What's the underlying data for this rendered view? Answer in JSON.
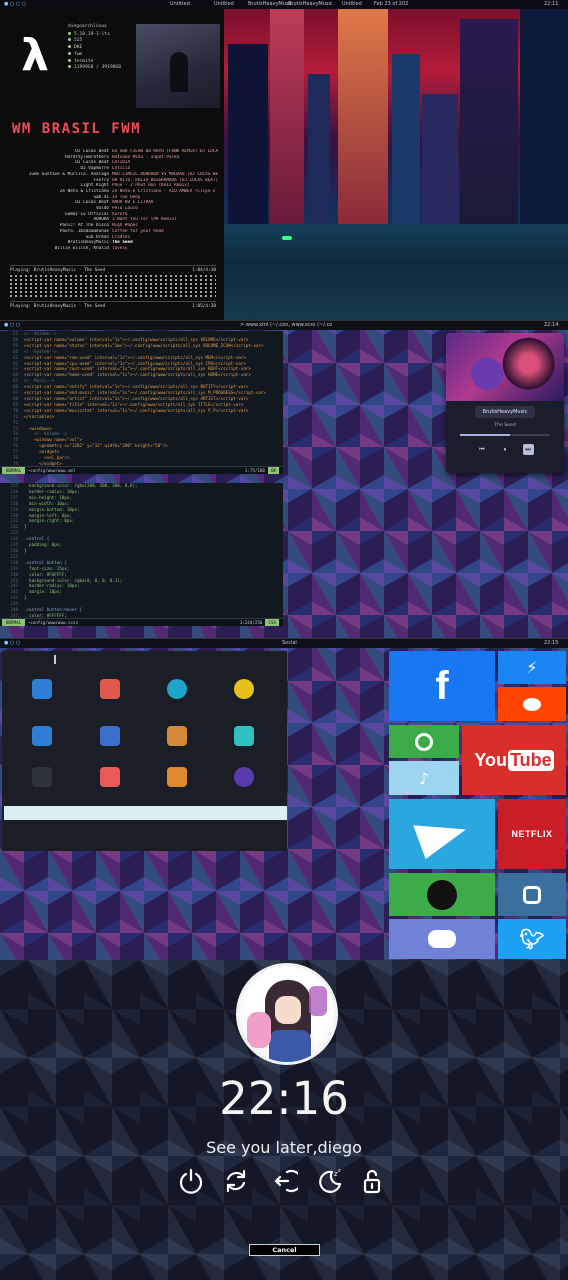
{
  "panel1": {
    "bar": {
      "tabs": [
        "Untitled",
        "Untitled",
        "BrutisHeavyMusic",
        "BrutisHeavyMusic",
        "Untitled"
      ],
      "status_text": "Feb 23 of 202",
      "time": "22:11"
    },
    "fetch": {
      "user": "diegoarchlinux",
      "lines": [
        "5.18.19-1-lts",
        "525",
        "DKE",
        "fwm",
        "termite",
        "11999GB / 39198GB"
      ]
    },
    "station": "WM BRASIL FWM",
    "songs": [
      {
        "artist": "DJ Lucas Beat",
        "title": "EU SOU FILHO DO RAYO (FUNK REMIX) DJ LUCA"
      },
      {
        "artist": "HardstyleBrothers",
        "title": "Hatsune Miku - Inpot Polka"
      },
      {
        "artist": "DJ Lucas Beat",
        "title": "LATIDIA"
      },
      {
        "artist": "DJ Vapmorre",
        "title": "Leticia"
      },
      {
        "artist": "Jude Gustave & Murillo. Analaga",
        "title": "MEU LIMEIL DOBRADO VS MAGRÃO (DJ LUCAS BE"
      },
      {
        "artist": "Fserry",
        "title": "OH RITO, POLIA DESGRAMADA (DJ LUCAS BEAT)"
      },
      {
        "artist": "Light Right",
        "title": "Phue - 2 Phut Hon (KAIZ Remix)"
      },
      {
        "artist": "Zé Neto & Cristiano",
        "title": "Zé Neto e Cristiano - ALÔ AMBEV (Clipe o"
      },
      {
        "artist": "Sam 41",
        "title": "In Too Deep"
      },
      {
        "artist": "DJ Lucas Beat",
        "title": "AMOR DU É LITRÃO"
      },
      {
        "artist": "Valdo",
        "title": "Pelo Louco"
      },
      {
        "artist": "Gomez Lo Official",
        "title": "Aurora"
      },
      {
        "artist": "AURORA",
        "title": "I Want You For (PK Remix)"
      },
      {
        "artist": "Panic! At The Disco",
        "title": "High Hopes"
      },
      {
        "artist": "Paufo. Imadamaduhae",
        "title": "Coffee for your head"
      },
      {
        "artist": "Sub Urban",
        "title": "Cradles"
      },
      {
        "artist": "BrutisHeavyMusic",
        "title": "The Seed"
      },
      {
        "artist": "Billie Eilish, Khalid",
        "title": "lovely"
      }
    ],
    "playing": "Playing: BrutisHeavyMusic - The Seed",
    "time_a": "1:04/4:30",
    "time_b": "1:05/4:30"
  },
  "panel2": {
    "bar": {
      "text": "> www.xml (~/.con, www.scss (~/.co",
      "time": "22:14"
    },
    "code_top": [
      {
        "n": "57",
        "t": "<!--Volume-->"
      },
      {
        "n": "58",
        "t": "<script-var name=\"volume\" interval=\"1s\">~/.config/www/scripts/all_sys VOLUME</script-var>"
      },
      {
        "n": "59",
        "t": "<script-var name=\"status\" interval=\"1ms\">~/.config/www/scripts/all_sys VOLUME_ICON</script-var>"
      },
      {
        "n": "60",
        "t": "<!--System-->"
      },
      {
        "n": "61",
        "t": "<script-var name=\"ram-used\" interval=\"1s\">~/.config/www/scripts/all_sys MEM</script-var>"
      },
      {
        "n": "62",
        "t": "<script-var name=\"cpu-used\" interval=\"1s\">~/.config/www/scripts/all_sys CPU</script-var>"
      },
      {
        "n": "63",
        "t": "<script-var name=\"root-used\" interval=\"1s\">~/.config/www/scripts/all_sys ROOT</script-var>"
      },
      {
        "n": "64",
        "t": "<script-var name=\"home-used\" interval=\"1s\">~/.config/www/scripts/all_sys HOME</script-var>"
      },
      {
        "n": "65",
        "t": "<!--Music-->"
      },
      {
        "n": "66",
        "t": "<script-var name=\"notify\" interval=\"1s\">~/.config/www/scripts/all_sys NOTIFY</script-var>"
      },
      {
        "n": "67",
        "t": "<script-var name=\"end-music\" interval=\"1s\">~/.config/www/scripts/all_sys M_PROGRESS</script-var>"
      },
      {
        "n": "68",
        "t": "<script-var name=\"artist\" interval=\"1s\">~/.config/www/scripts/all_sys ARTIST</script-var>"
      },
      {
        "n": "69",
        "t": "<script-var name=\"title\" interval=\"1s\">~/.config/www/scripts/all_sys TITLE</script-var>"
      },
      {
        "n": "70",
        "t": "<script-var name=\"musicstat\" interval=\"1s\">~/.config/www/scripts/all_sys P_P</script-var>"
      },
      {
        "n": "71",
        "t": "</variables>"
      },
      {
        "n": "72",
        "t": ""
      },
      {
        "n": "73",
        "t": "  <windows>"
      },
      {
        "n": "74",
        "t": "    <!--Volume-->"
      },
      {
        "n": "75",
        "t": "    <window name=\"vol\">"
      },
      {
        "n": "76",
        "t": "      <geometry x=\"1282\" y=\"32\" width=\"200\" height=\"50\"/>"
      },
      {
        "n": "77",
        "t": "      <widget>"
      },
      {
        "n": "78",
        "t": "        <vol_bar/>"
      },
      {
        "n": "79",
        "t": "      </widget>"
      },
      {
        "n": "80",
        "t": "    </window>"
      }
    ],
    "status_top": {
      "mode": "NORMAL",
      "file": "~config/www/www.xml",
      "pos": "1:75/180",
      "ok": "OK"
    },
    "code_bottom": [
      {
        "n": "225",
        "t": "  background-color: rgba(200, 200, 200, 0.6);"
      },
      {
        "n": "226",
        "t": "  border-radius: 10px;"
      },
      {
        "n": "227",
        "t": "  min-height: 10px;"
      },
      {
        "n": "228",
        "t": "  min-width: 10px;"
      },
      {
        "n": "229",
        "t": "  margin-bottom: 10px;"
      },
      {
        "n": "230",
        "t": "  margin-left: 0px;"
      },
      {
        "n": "231",
        "t": "  margin-right: 0px;"
      },
      {
        "n": "232",
        "t": "}"
      },
      {
        "n": "233",
        "t": ""
      },
      {
        "n": "234",
        "t": ".control {"
      },
      {
        "n": "235",
        "t": "  padding: 0px;"
      },
      {
        "n": "236",
        "t": "}"
      },
      {
        "n": "237",
        "t": ""
      },
      {
        "n": "238",
        "t": ".control button {"
      },
      {
        "n": "239",
        "t": "  font-size: 15px;"
      },
      {
        "n": "240",
        "t": "  color: #FOFFFF;"
      },
      {
        "n": "241",
        "t": "  background-color: rgba(0, 0, 0, 0.1);"
      },
      {
        "n": "242",
        "t": "  border-radius: 10px;"
      },
      {
        "n": "243",
        "t": "  margin: 10px;"
      },
      {
        "n": "244",
        "t": "}"
      },
      {
        "n": "245",
        "t": ""
      },
      {
        "n": "246",
        "t": ".control button:hover {"
      },
      {
        "n": "247",
        "t": "  color: #FFFFFF;"
      },
      {
        "n": "248",
        "t": "  background-color: rgba(200, 200, 200, 0.3);"
      },
      {
        "n": "249",
        "t": "  border-radius: 10px;"
      },
      {
        "n": "250",
        "t": "}"
      }
    ],
    "status_bottom": {
      "mode": "NORMAL",
      "file": "~config/www/www.scss",
      "pos": "1:244/256",
      "ok": "CSS"
    },
    "player": {
      "artist": "BrutisHeavyMusic",
      "song": "The Seed",
      "progress": 0.55
    }
  },
  "panel3": {
    "bar": {
      "title": "Social",
      "time": "22:15"
    },
    "apps": [
      {
        "name": "files",
        "color": "#2d7fd6"
      },
      {
        "name": "screen-recorder",
        "color": "#e05a4c"
      },
      {
        "name": "globe",
        "color": "#1ea3c9"
      },
      {
        "name": "chrome",
        "color": "#e8c21c"
      },
      {
        "name": "window-manager",
        "color": "#2d7fd6"
      },
      {
        "name": "notifications",
        "color": "#3b6fcf"
      },
      {
        "name": "package-installer",
        "color": "#d58a3a"
      },
      {
        "name": "settings",
        "color": "#2fc0c0"
      },
      {
        "name": "terminal",
        "color": "#2c333c"
      },
      {
        "name": "media-player",
        "color": "#e85a5a"
      },
      {
        "name": "screenshot",
        "color": "#e08a30"
      },
      {
        "name": "brave-browser",
        "color": "#5b3ab0"
      }
    ],
    "tiles": {
      "youtube": {
        "you": "You",
        "tube": "Tube"
      },
      "netflix": "NETFLIX",
      "facebook": "f"
    }
  },
  "panel4": {
    "time": "22:16",
    "message": "See you later,diego",
    "cancel": "Cancel"
  },
  "colors": {
    "facebook": "#1877f2",
    "messenger": "#1a86f3",
    "reddit": "#ff4500",
    "whatsapp": "#3cab4a",
    "youtube": "#d7302a",
    "tiktok": "#9dd4f0",
    "telegram": "#2ba7e0",
    "netflix": "#c81f26",
    "spotify": "#1ed760",
    "instagram": "#3a6f9e",
    "discord": "#6f82d8",
    "twitter": "#1da1f2"
  }
}
